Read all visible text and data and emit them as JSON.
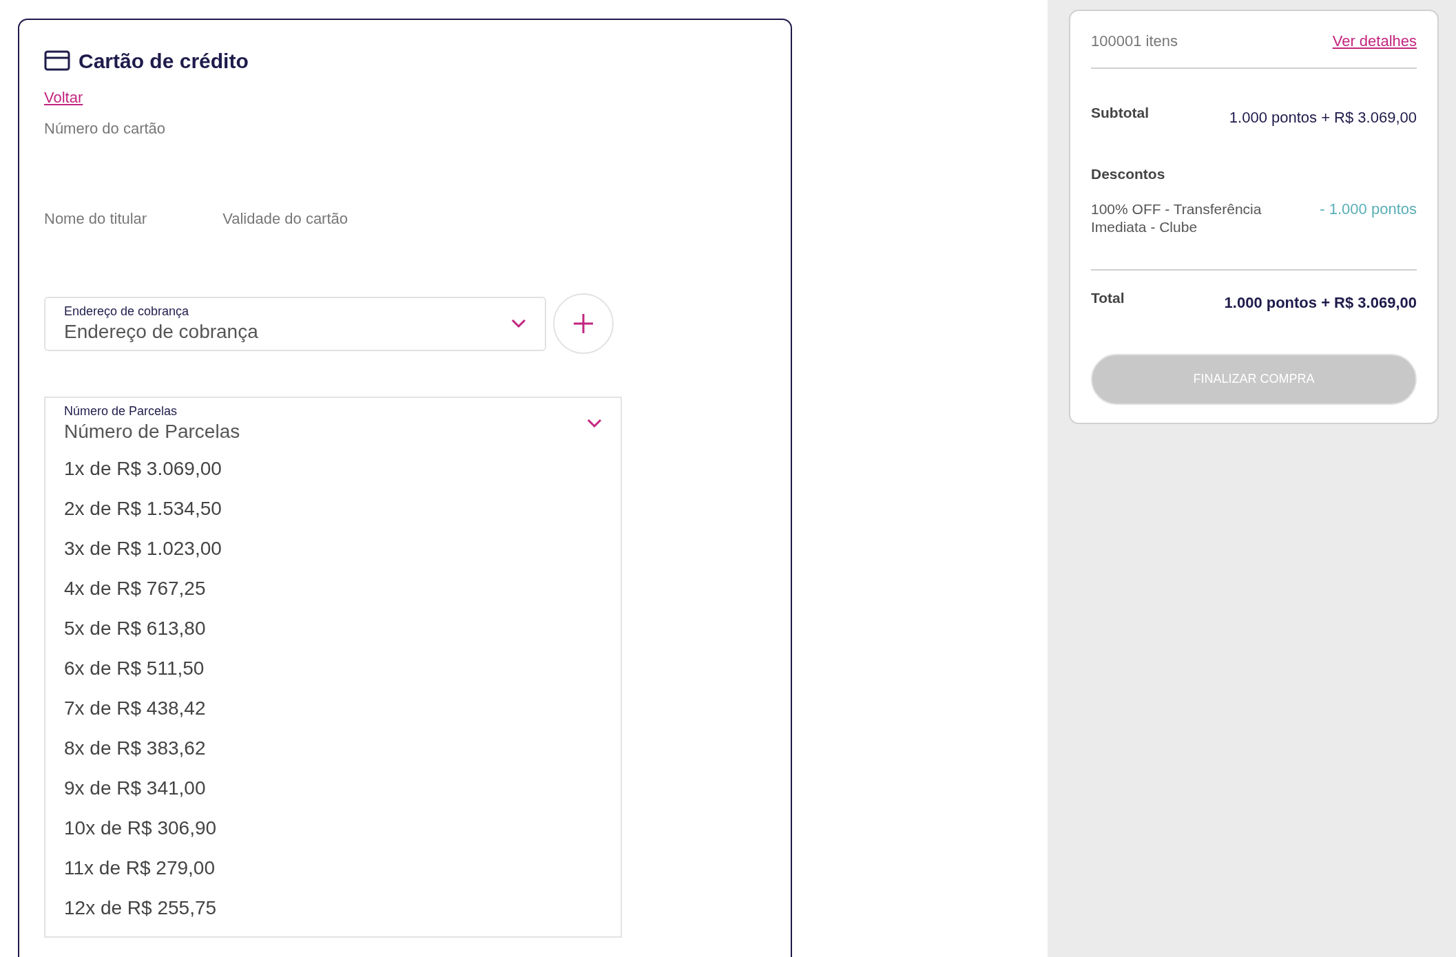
{
  "payment": {
    "title": "Cartão de crédito",
    "back_link": "Voltar",
    "card_number_label": "Número do cartão",
    "holder_label": "Nome do titular",
    "expiry_label": "Validade do cartão",
    "billing_address": {
      "label": "Endereço de cobrança",
      "placeholder": "Endereço de cobrança"
    },
    "installments": {
      "label": "Número de Parcelas",
      "placeholder": "Número de Parcelas",
      "expanded": true,
      "options": [
        {
          "text": "1x de R$ 3.069,00"
        },
        {
          "text": "2x de R$ 1.534,50"
        },
        {
          "text": "3x de R$ 1.023,00"
        },
        {
          "text": "4x de R$ 767,25"
        },
        {
          "text": "5x de R$ 613,80"
        },
        {
          "text": "6x de R$ 511,50"
        },
        {
          "text": "7x de R$ 438,42"
        },
        {
          "text": "8x de R$ 383,62"
        },
        {
          "text": "9x de R$ 341,00"
        },
        {
          "text": "10x de R$ 306,90"
        },
        {
          "text": "11x de R$ 279,00"
        },
        {
          "text": "12x de R$ 255,75"
        }
      ]
    }
  },
  "summary": {
    "items_count": "100001 itens",
    "details_link": "Ver detalhes",
    "subtotal_label": "Subtotal",
    "subtotal_value": "1.000 pontos + R$ 3.069,00",
    "discounts_label": "Descontos",
    "discounts": [
      {
        "name": "100% OFF - Transferência Imediata - Clube",
        "value": "- 1.000 pontos"
      }
    ],
    "total_label": "Total",
    "total_value": "1.000 pontos + R$ 3.069,00",
    "checkout_button": {
      "label": "FINALIZAR COMPRA",
      "disabled": true
    }
  }
}
